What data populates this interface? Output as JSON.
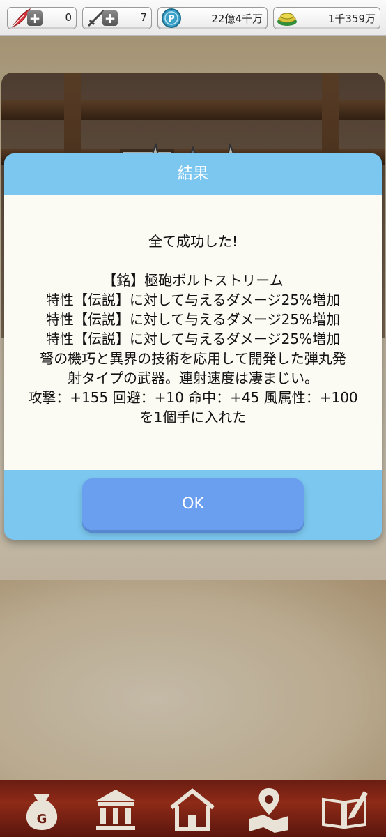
{
  "resources": [
    {
      "name": "feather",
      "value": "0",
      "icon": "red-feather-icon"
    },
    {
      "name": "sword",
      "value": "7",
      "icon": "sword-icon"
    },
    {
      "name": "points",
      "value": "22億4千万",
      "icon": "p-coin-icon"
    },
    {
      "name": "gold",
      "value": "1千359万",
      "icon": "gold-coins-icon"
    }
  ],
  "dialog": {
    "title": "結果",
    "lines": [
      "全て成功した!",
      "",
      "【銘】極砲ボルトストリーム",
      "特性【伝説】に対して与えるダメージ25%増加",
      "特性【伝説】に対して与えるダメージ25%増加",
      "特性【伝説】に対して与えるダメージ25%増加",
      "弩の機巧と異界の技術を応用して開発した弾丸発",
      "射タイプの武器。連射速度は凄まじい。",
      "攻撃：+155 回避：+10 命中：+45 風属性：+100",
      "を1個手に入れた"
    ],
    "ok_label": "OK"
  },
  "bottom_nav": [
    {
      "name": "bag",
      "icon": "money-bag-icon"
    },
    {
      "name": "bank",
      "icon": "bank-icon"
    },
    {
      "name": "home",
      "icon": "house-icon"
    },
    {
      "name": "map",
      "icon": "map-pin-icon"
    },
    {
      "name": "book",
      "icon": "book-pen-icon"
    }
  ]
}
